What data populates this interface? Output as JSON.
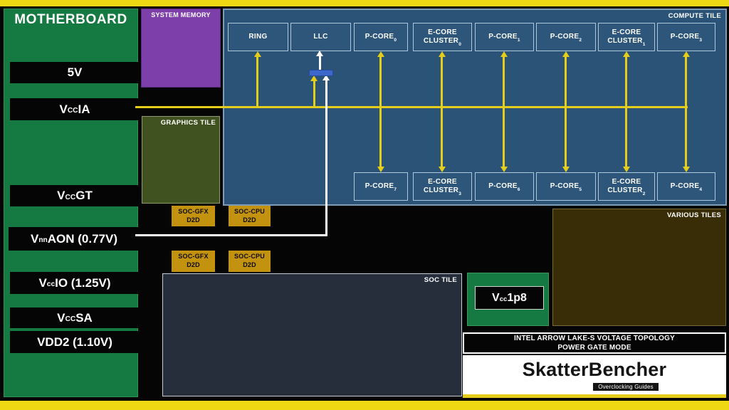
{
  "motherboard": {
    "title": "MOTHERBOARD",
    "rails": [
      {
        "pre": "5V",
        "sub": "",
        "post": ""
      },
      {
        "pre": "V",
        "sub": "CC",
        "post": "IA"
      },
      {
        "pre": "V",
        "sub": "CC",
        "post": "GT"
      },
      {
        "pre": "V",
        "sub": "nn",
        "post": "AON (0.77V)"
      },
      {
        "pre": "V",
        "sub": "cc",
        "post": "IO (1.25V)"
      },
      {
        "pre": "V",
        "sub": "CC",
        "post": "SA"
      },
      {
        "pre": "VDD2 (1.10V)",
        "sub": "",
        "post": ""
      }
    ]
  },
  "system_memory": {
    "label": "SYSTEM MEMORY"
  },
  "compute_tile": {
    "label": "COMPUTE TILE",
    "top_row": [
      {
        "t": "",
        "m": "RING",
        "sub": ""
      },
      {
        "t": "",
        "m": "LLC",
        "sub": ""
      },
      {
        "t": "",
        "m": "P-CORE",
        "sub": "0"
      },
      {
        "t": "E-CORE",
        "m": "CLUSTER",
        "sub": "0"
      },
      {
        "t": "",
        "m": "P-CORE",
        "sub": "1"
      },
      {
        "t": "",
        "m": "P-CORE",
        "sub": "2"
      },
      {
        "t": "E-CORE",
        "m": "CLUSTER",
        "sub": "1"
      },
      {
        "t": "",
        "m": "P-CORE",
        "sub": "3"
      }
    ],
    "bottom_row": [
      {
        "t": "",
        "m": "P-CORE",
        "sub": "7"
      },
      {
        "t": "E-CORE",
        "m": "CLUSTER",
        "sub": "3"
      },
      {
        "t": "",
        "m": "P-CORE",
        "sub": "6"
      },
      {
        "t": "",
        "m": "P-CORE",
        "sub": "5"
      },
      {
        "t": "E-CORE",
        "m": "CLUSTER",
        "sub": "2"
      },
      {
        "t": "",
        "m": "P-CORE",
        "sub": "4"
      }
    ]
  },
  "graphics_tile": {
    "label": "GRAPHICS TILE"
  },
  "d2d": {
    "row1": [
      {
        "l1": "SOC-GFX",
        "l2": "D2D"
      },
      {
        "l1": "SOC-CPU",
        "l2": "D2D"
      }
    ],
    "row2": [
      {
        "l1": "SOC-GFX",
        "l2": "D2D"
      },
      {
        "l1": "SOC-CPU",
        "l2": "D2D"
      }
    ]
  },
  "soc_tile": {
    "label": "SOC TILE"
  },
  "various_tiles": {
    "label": "VARIOUS TILES"
  },
  "vcc1p8": {
    "pre": "V",
    "sub": "cc",
    "post": "1p8"
  },
  "footer": {
    "title_line1": "INTEL ARROW LAKE-S VOLTAGE TOPOLOGY",
    "title_line2": "POWER GATE MODE",
    "brand": "SkatterBencher",
    "brand_sub": "Overclocking Guides"
  },
  "colors": {
    "border_yellow": "#eed813",
    "power_line_yellow": "#e5ce1b",
    "power_line_white": "#ffffff",
    "motherboard_green": "#157a41",
    "memory_purple": "#7d3fa9",
    "compute_blue": "#2b5377",
    "power_gate_blue": "#3c67cb",
    "graphics_olive": "#40521f",
    "d2d_gold": "#c3920e",
    "soc_navy": "#262d3b",
    "various_brown": "#382d07",
    "background_black": "#050505"
  }
}
